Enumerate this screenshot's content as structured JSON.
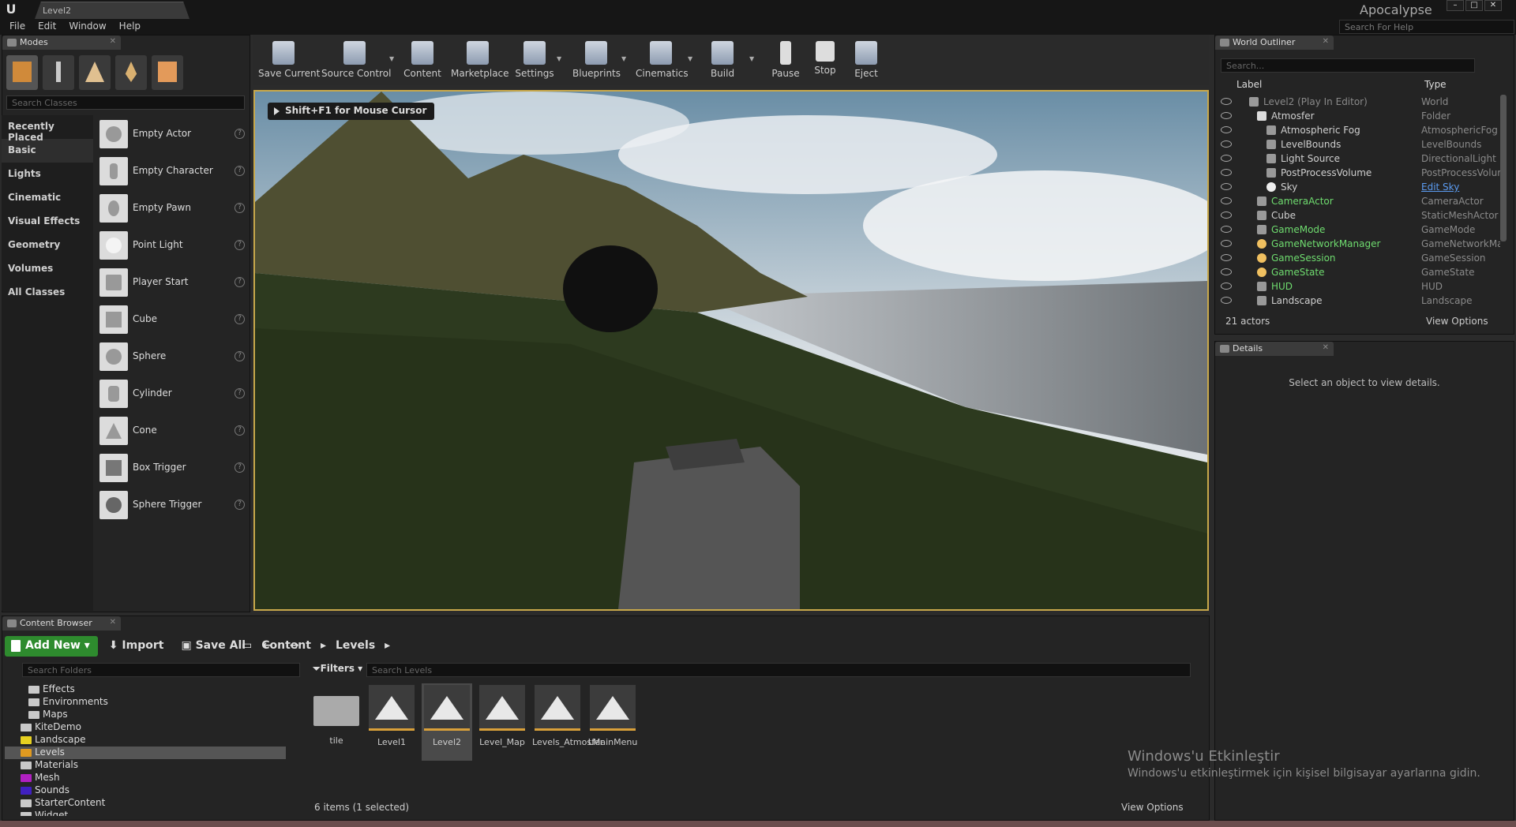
{
  "titlebar": {
    "level_tab": "Level2",
    "project": "Apocalypse",
    "search_help_placeholder": "Search For Help"
  },
  "menu": [
    "File",
    "Edit",
    "Window",
    "Help"
  ],
  "modes": {
    "tab": "Modes",
    "search_placeholder": "Search Classes",
    "categories": [
      "Recently Placed",
      "Basic",
      "Lights",
      "Cinematic",
      "Visual Effects",
      "Geometry",
      "Volumes",
      "All Classes"
    ],
    "classes": [
      "Empty Actor",
      "Empty Character",
      "Empty Pawn",
      "Point Light",
      "Player Start",
      "Cube",
      "Sphere",
      "Cylinder",
      "Cone",
      "Box Trigger",
      "Sphere Trigger"
    ]
  },
  "toolbar": [
    "Save Current",
    "Source Control",
    "Content",
    "Marketplace",
    "Settings",
    "Blueprints",
    "Cinematics",
    "Build",
    "Pause",
    "Stop",
    "Eject"
  ],
  "viewport": {
    "hint": "Shift+F1 for Mouse Cursor"
  },
  "outliner": {
    "tab": "World Outliner",
    "search_placeholder": "Search...",
    "col_label": "Label",
    "col_type": "Type",
    "rows": [
      {
        "label": "Level2 (Play In Editor)",
        "type": "World"
      },
      {
        "label": "Atmosfer",
        "type": "Folder"
      },
      {
        "label": "Atmospheric Fog",
        "type": "AtmosphericFog"
      },
      {
        "label": "LevelBounds",
        "type": "LevelBounds"
      },
      {
        "label": "Light Source",
        "type": "DirectionalLight"
      },
      {
        "label": "PostProcessVolume",
        "type": "PostProcessVolur"
      },
      {
        "label": "Sky",
        "type": "Edit Sky"
      },
      {
        "label": "CameraActor",
        "type": "CameraActor"
      },
      {
        "label": "Cube",
        "type": "StaticMeshActor"
      },
      {
        "label": "GameMode",
        "type": "GameMode"
      },
      {
        "label": "GameNetworkManager",
        "type": "GameNetworkMar"
      },
      {
        "label": "GameSession",
        "type": "GameSession"
      },
      {
        "label": "GameState",
        "type": "GameState"
      },
      {
        "label": "HUD",
        "type": "HUD"
      },
      {
        "label": "Landscape",
        "type": "Landscape"
      }
    ],
    "count": "21 actors",
    "view_options": "View Options"
  },
  "details": {
    "tab": "Details",
    "empty": "Select an object to view details."
  },
  "content_browser": {
    "tab": "Content Browser",
    "add_new": "Add New",
    "import": "Import",
    "save_all": "Save All",
    "crumbs": [
      "Content",
      "Levels"
    ],
    "search_folders": "Search Folders",
    "filters": "Filters",
    "search_levels": "Search Levels",
    "folders": [
      "Effects",
      "Environments",
      "Maps",
      "KiteDemo",
      "Landscape",
      "Levels",
      "Materials",
      "Mesh",
      "Sounds",
      "StarterContent",
      "Widget"
    ],
    "assets": [
      "tile",
      "Level1",
      "Level2",
      "Level_Map",
      "Levels_Atmosfer",
      "LMainMenu"
    ],
    "count": "6 items (1 selected)",
    "view_options": "View Options"
  },
  "watermark": {
    "title": "Windows'u Etkinleştir",
    "subtitle": "Windows'u etkinleştirmek için kişisel bilgisayar ayarlarına gidin."
  }
}
